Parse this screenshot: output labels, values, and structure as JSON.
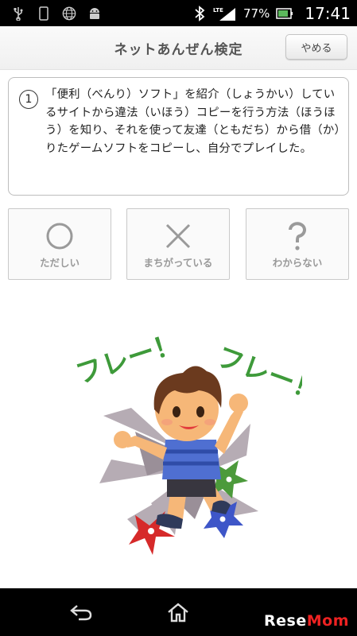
{
  "status_bar": {
    "icons": [
      "usb-icon",
      "phone-icon",
      "globe-icon",
      "android-icon",
      "bluetooth-icon",
      "lte-signal-icon",
      "battery-icon"
    ],
    "network": "LTE",
    "battery_percent": "77%",
    "time": "17:41"
  },
  "header": {
    "title": "ネットあんぜん検定",
    "quit_label": "やめる"
  },
  "question": {
    "number": "1",
    "text": "「便利（べんり）ソフト」を紹介（しょうかい）しているサイトから違法（いほう）コピーを行う方法（ほうほう）を知り、それを使って友達（ともだち）から借（か）りたゲームソフトをコピーし、自分でプレイした。"
  },
  "answers": [
    {
      "icon": "circle-icon",
      "label": "ただしい"
    },
    {
      "icon": "cross-icon",
      "label": "まちがっている"
    },
    {
      "icon": "question-mark-icon",
      "label": "わからない"
    }
  ],
  "illustration": {
    "cheer_left": "フレー！",
    "cheer_right": "フレー！"
  },
  "nav_bar": {
    "icons": [
      "back-icon",
      "home-icon"
    ]
  },
  "watermark": {
    "text_a": "Rese",
    "text_b": "Mom"
  },
  "colors": {
    "cheer_green": "#3e9a3a",
    "shirt_blue": "#4f6fd1",
    "skin": "#f6b778",
    "hair": "#6b3a1e"
  }
}
